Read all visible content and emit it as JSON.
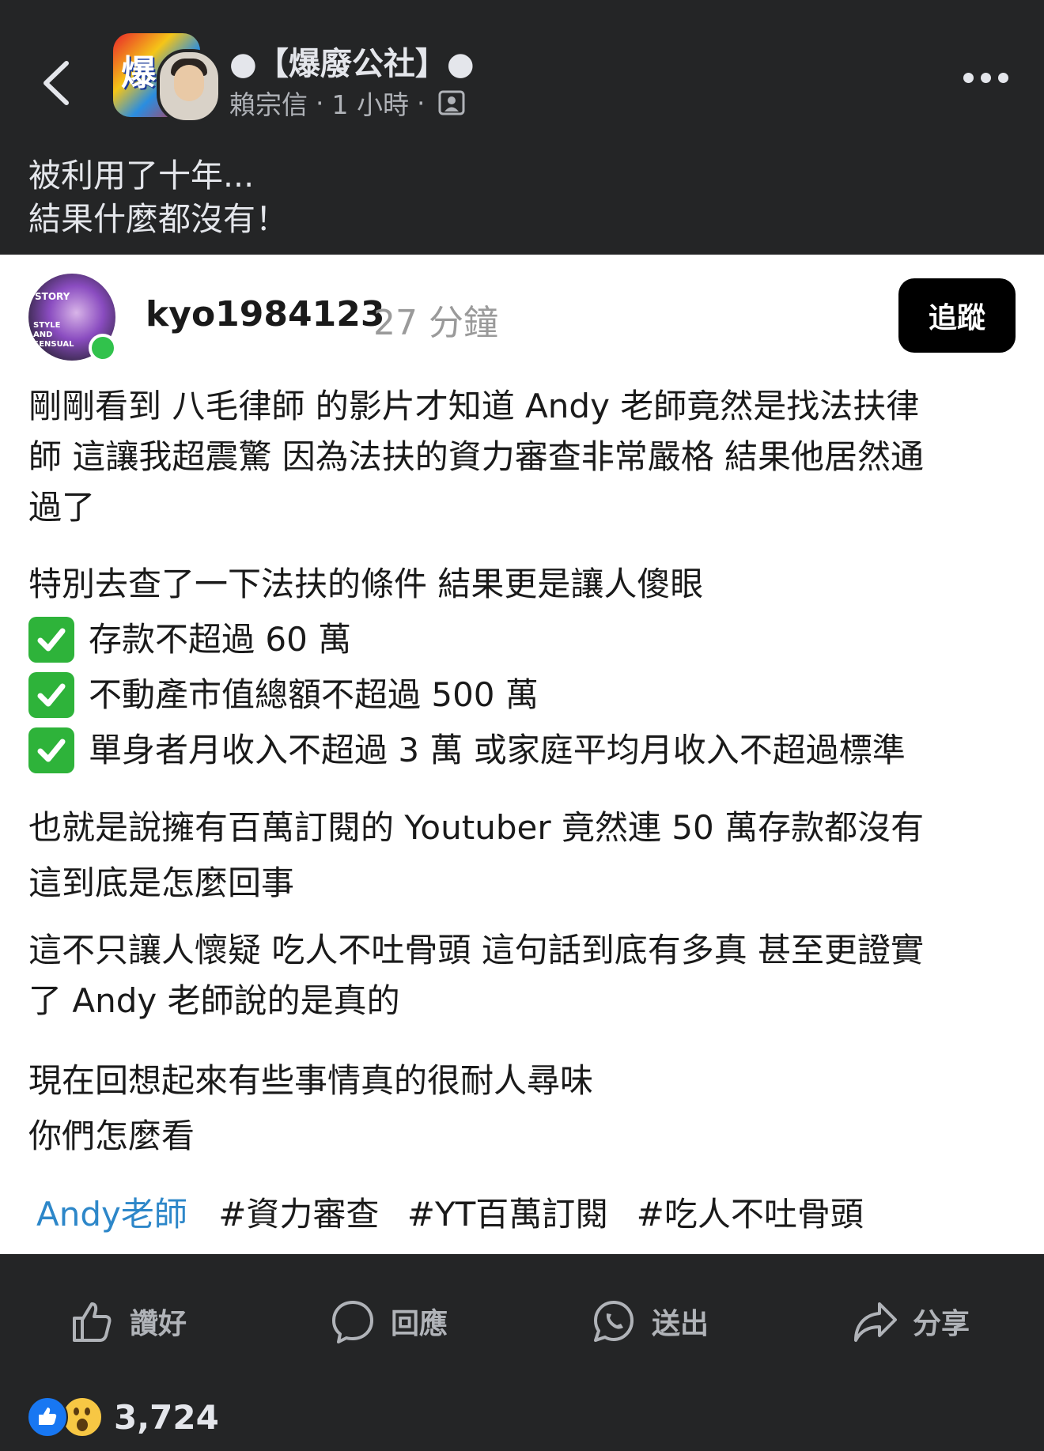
{
  "header": {
    "group_name": "●【爆廢公社】●",
    "author": "賴宗信",
    "separator": "·",
    "time": "1 小時",
    "icons": {
      "back": "chevron-left-icon",
      "more": "more-horizontal-icon",
      "audience": "group-icon"
    }
  },
  "caption": {
    "lines": [
      "被利用了十年...",
      "結果什麼都沒有！"
    ]
  },
  "embedded_post": {
    "username": "kyo1984123",
    "time": "27 分鐘",
    "follow_label": "追蹤",
    "avatar_text_1": "STORY",
    "avatar_text_2": "STYLE AND SENSUAL",
    "paragraph1": [
      "剛剛看到 八毛律師 的影片才知道 Andy 老師竟然是找法扶律",
      "師 這讓我超震驚 因為法扶的資力審查非常嚴格 結果他居然通",
      "過了"
    ],
    "conditions_intro": "特別去查了一下法扶的條件 結果更是讓人傻眼",
    "conditions": [
      "存款不超過 60 萬",
      "不動產市值總額不超過 500 萬",
      "單身者月收入不超過 3 萬 或家庭平均月收入不超過標準"
    ],
    "paragraph3": [
      "也就是說擁有百萬訂閱的 Youtuber 竟然連 50 萬存款都沒有",
      "這到底是怎麼回事"
    ],
    "paragraph4": [
      "這不只讓人懷疑 吃人不吐骨頭 這句話到底有多真 甚至更證實",
      "了 Andy 老師說的是真的"
    ],
    "paragraph5": [
      "現在回想起來有些事情真的很耐人尋味",
      "你們怎麼看"
    ],
    "tag_link": "Andy老師",
    "tags": [
      "#資力審查",
      "#YT百萬訂閱",
      "#吃人不吐骨頭"
    ]
  },
  "actions": {
    "like": "讚好",
    "comment": "回應",
    "send": "送出",
    "share": "分享"
  },
  "reactions": {
    "count": "3,724",
    "types": [
      "like",
      "wow"
    ]
  },
  "colors": {
    "background": "#242526",
    "card": "#ffffff",
    "link": "#2d87c9",
    "check": "#2eb33a",
    "like_blue": "#1877f2"
  }
}
